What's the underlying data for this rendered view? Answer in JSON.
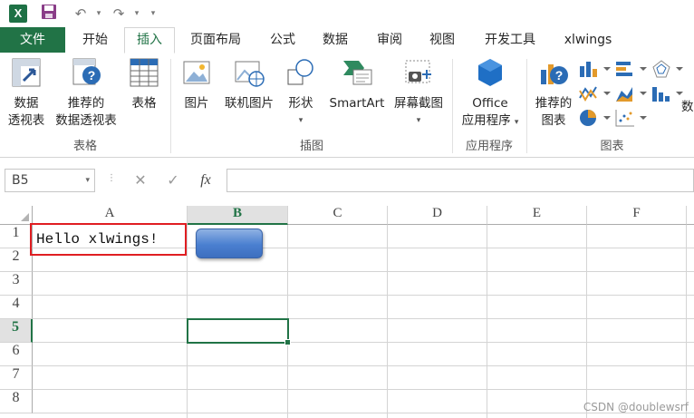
{
  "qat": {
    "app_logo": "X",
    "save_icon": "save-icon",
    "undo_icon": "undo-icon",
    "redo_icon": "redo-icon"
  },
  "tabs": [
    "文件",
    "开始",
    "插入",
    "页面布局",
    "公式",
    "数据",
    "审阅",
    "视图",
    "开发工具",
    "xlwings"
  ],
  "active_tab": "插入",
  "ribbon": {
    "groups": {
      "tables": "表格",
      "illustrations": "插图",
      "apps": "应用程序",
      "charts": "图表"
    },
    "buttons": {
      "pivot_line1": "数据",
      "pivot_line2": "透视表",
      "rec_pivot_line1": "推荐的",
      "rec_pivot_line2": "数据透视表",
      "table": "表格",
      "picture": "图片",
      "online_picture": "联机图片",
      "shapes": "形状",
      "smartart": "SmartArt",
      "screenshot": "屏幕截图",
      "office_line1": "Office",
      "office_line2": "应用程序",
      "rec_chart_line1": "推荐的",
      "rec_chart_line2": "图表",
      "cut_off": "数"
    }
  },
  "formula_bar": {
    "name_box": "B5",
    "cancel": "✕",
    "enter": "✓",
    "fx": "fx",
    "value": ""
  },
  "grid": {
    "columns": [
      "A",
      "B",
      "C",
      "D",
      "E",
      "F"
    ],
    "selected_column": "B",
    "rows": [
      "1",
      "2",
      "3",
      "4",
      "5",
      "6",
      "7",
      "8"
    ],
    "selected_row": "5",
    "cells": {
      "A1": "Hello xlwings!"
    },
    "active_cell": "B5"
  },
  "colors": {
    "accent": "#217346",
    "highlight_box": "#e01e22",
    "shape_fill": "#4a7fd0"
  },
  "watermark": "CSDN @doublewsrf"
}
